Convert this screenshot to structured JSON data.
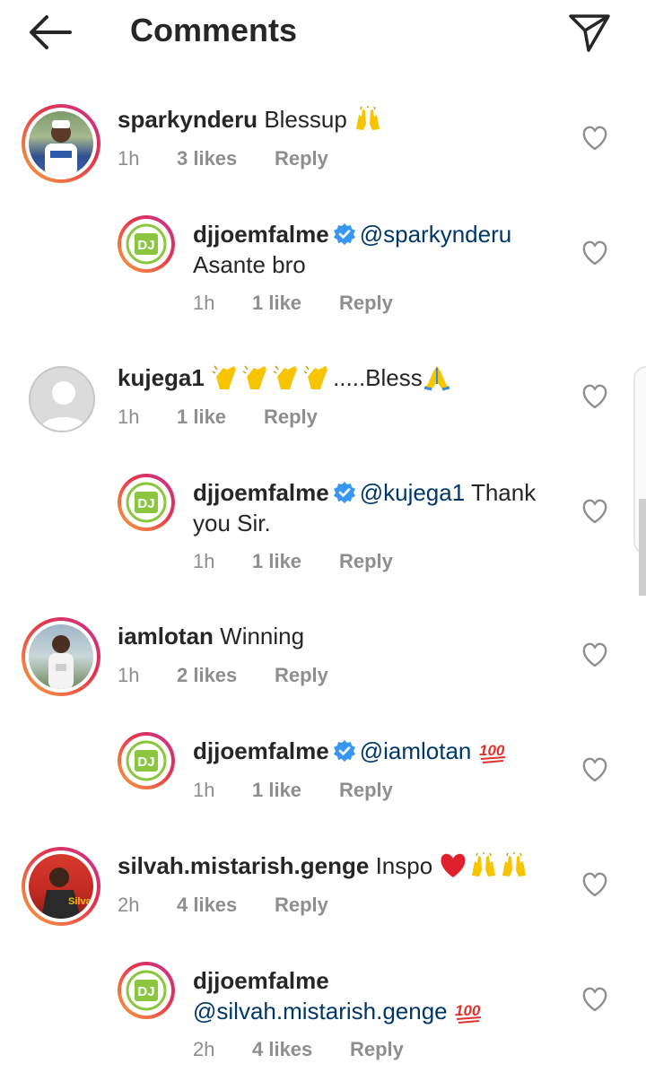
{
  "header": {
    "title": "Comments",
    "back_icon": "arrow-left-icon",
    "send_icon": "paper-plane-icon"
  },
  "comments": [
    {
      "username": "sparkynderu",
      "text": "Blessup",
      "emoji": [
        "raising-hands"
      ],
      "time": "1h",
      "likes": "3 likes",
      "reply": "Reply"
    },
    {
      "username": "djjoemfalme",
      "mention": "@sparkynderu",
      "text": "Asante bro",
      "time": "1h",
      "likes": "1 like",
      "reply": "Reply"
    },
    {
      "username": "kujega1",
      "text": ".....Bless",
      "emoji": [
        "clapping-hands",
        "clapping-hands",
        "clapping-hands",
        "clapping-hands",
        "folded-hands"
      ],
      "time": "1h",
      "likes": "1 like",
      "reply": "Reply"
    },
    {
      "username": "djjoemfalme",
      "mention": "@kujega1",
      "text_a": "Thank",
      "text_b": "you Sir.",
      "time": "1h",
      "likes": "1 like",
      "reply": "Reply"
    },
    {
      "username": "iamlotan",
      "text": "Winning",
      "time": "1h",
      "likes": "2 likes",
      "reply": "Reply"
    },
    {
      "username": "djjoemfalme",
      "mention": "@iamlotan",
      "emoji": [
        "hundred-points"
      ],
      "time": "1h",
      "likes": "1 like",
      "reply": "Reply"
    },
    {
      "username": "silvah.mistarish.genge",
      "text": "Inspo",
      "emoji": [
        "red-heart",
        "raising-hands",
        "raising-hands"
      ],
      "time": "2h",
      "likes": "4 likes",
      "reply": "Reply"
    },
    {
      "username": "djjoemfalme",
      "mention": "@silvah.mistarish.genge",
      "emoji": [
        "hundred-points"
      ],
      "time": "2h",
      "likes": "4 likes",
      "reply": "Reply"
    }
  ],
  "colors": {
    "text": "#262626",
    "meta": "#8e8e8e",
    "mention": "#00376b",
    "verified": "#3897f0",
    "logo_green": "#8cc63f"
  }
}
